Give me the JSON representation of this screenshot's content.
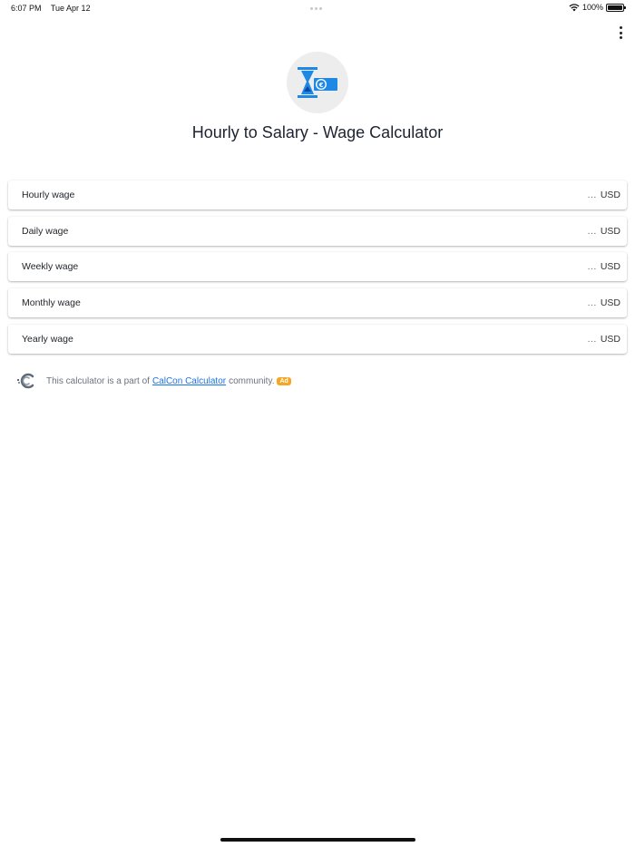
{
  "status_bar": {
    "time": "6:07 PM",
    "date": "Tue Apr 12",
    "battery": "100%"
  },
  "app": {
    "title": "Hourly to Salary - Wage Calculator",
    "icon": "hourglass-money-icon"
  },
  "rows": [
    {
      "label": "Hourly wage",
      "placeholder": "...",
      "unit": "USD"
    },
    {
      "label": "Daily wage",
      "placeholder": "...",
      "unit": "USD"
    },
    {
      "label": "Weekly wage",
      "placeholder": "...",
      "unit": "USD"
    },
    {
      "label": "Monthly wage",
      "placeholder": "...",
      "unit": "USD"
    },
    {
      "label": "Yearly wage",
      "placeholder": "...",
      "unit": "USD"
    }
  ],
  "community": {
    "text_before": "This calculator is a part of",
    "link_text": "CalCon Calculator",
    "text_after": "community.",
    "ad_badge": "Ad"
  },
  "colors": {
    "accent": "#1a73e8",
    "ad_badge": "#f5a623",
    "icon_blue": "#1e88e5"
  }
}
